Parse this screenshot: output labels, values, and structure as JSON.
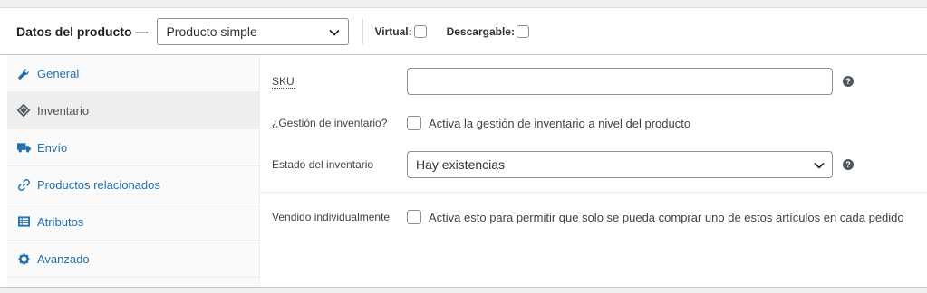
{
  "header": {
    "title": "Datos del producto —",
    "product_type": "Producto simple",
    "virtual_label": "Virtual:",
    "downloadable_label": "Descargable:"
  },
  "tabs": [
    {
      "label": "General",
      "icon": "wrench-icon"
    },
    {
      "label": "Inventario",
      "icon": "tag-icon"
    },
    {
      "label": "Envío",
      "icon": "truck-icon"
    },
    {
      "label": "Productos relacionados",
      "icon": "link-icon"
    },
    {
      "label": "Atributos",
      "icon": "list-icon"
    },
    {
      "label": "Avanzado",
      "icon": "gear-icon"
    }
  ],
  "inventory": {
    "sku_label": "SKU",
    "sku_value": "",
    "manage_stock_label": "¿Gestión de inventario?",
    "manage_stock_text": "Activa la gestión de inventario a nivel del producto",
    "stock_status_label": "Estado del inventario",
    "stock_status_value": "Hay existencias",
    "sold_individually_label": "Vendido individualmente",
    "sold_individually_text": "Activa esto para permitir que solo se pueda comprar uno de estos artículos en cada pedido"
  },
  "colors": {
    "link": "#2271b1",
    "active_tab_bg": "#eeeeee"
  }
}
